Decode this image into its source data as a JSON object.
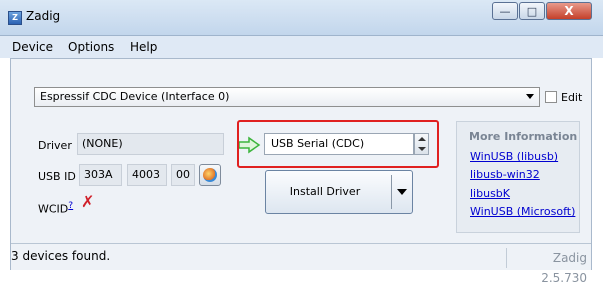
{
  "window": {
    "title": "Zadig",
    "app_icon": "Z"
  },
  "caption": {
    "minimize_icon": "—",
    "maximize_icon": "□",
    "close_icon": "X"
  },
  "menu": {
    "items": [
      "Device",
      "Options",
      "Help"
    ]
  },
  "device": {
    "selected": "Espressif CDC Device (Interface 0)",
    "edit_label": "Edit"
  },
  "driver": {
    "label": "Driver",
    "current": "(NONE)",
    "usbid_label": "USB ID",
    "vid": "303A",
    "pid": "4003",
    "mi": "00",
    "wcid_label": "WCID",
    "wcid_sup": "?",
    "wcid_icon": "✗",
    "target": "USB Serial (CDC)",
    "install_label": "Install Driver"
  },
  "info": {
    "title": "More Information",
    "links": [
      "WinUSB (libusb)",
      "libusb-win32",
      "libusbK",
      "WinUSB (Microsoft)"
    ]
  },
  "status": {
    "text": "3 devices found.",
    "version": "Zadig 2.5.730"
  },
  "colors": {
    "highlight_box": "#e02020",
    "link": "#0000d0",
    "arrow": "#3cb43c"
  }
}
